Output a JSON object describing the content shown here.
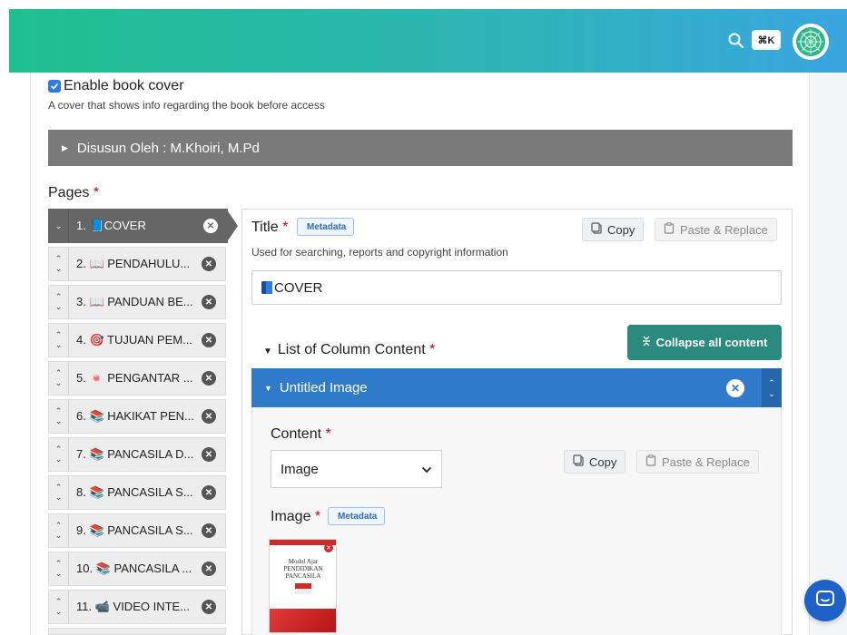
{
  "header": {
    "shortcut": "⌘K"
  },
  "cover": {
    "label": "Enable book cover",
    "help": "A cover that shows info regarding the book before access",
    "checked": true,
    "collapsible_title": "Disusun Oleh : M.Khoiri, M.Pd"
  },
  "pages": {
    "label": "Pages",
    "required": "*",
    "items": [
      {
        "label": "1. 📘COVER",
        "active": true
      },
      {
        "label": "2. 📖 PENDAHULU..."
      },
      {
        "label": "3. 📖 PANDUAN BE..."
      },
      {
        "label": "4. 🎯 TUJUAN PEM..."
      },
      {
        "label": "5. 🍬 PENGANTAR ..."
      },
      {
        "label": "6. 📚 HAKIKAT PEN..."
      },
      {
        "label": "7. 📚 PANCASILA D..."
      },
      {
        "label": "8. 📚 PANCASILA S..."
      },
      {
        "label": "9. 📚 PANCASILA S..."
      },
      {
        "label": "10. 📚 PANCASILA ..."
      },
      {
        "label": "11. 📹 VIDEO INTE..."
      }
    ]
  },
  "editor": {
    "title_label": "Title",
    "required": "*",
    "metadata_label": "Metadata",
    "title_help": "Used for searching, reports and copyright information",
    "title_value": "COVER",
    "copy_label": "Copy",
    "paste_label": "Paste & Replace",
    "list_label": "List of Column Content",
    "collapse_all_label": "Collapse all content",
    "item_title": "Untitled Image",
    "content_label": "Content",
    "content_value": "Image",
    "image_label": "Image",
    "thumb_text": "Modul Ajar PENDIDIKAN PANCASILA"
  },
  "colors": {
    "header_gradient_start": "#1fc08f",
    "header_gradient_end": "#3aa6e0",
    "accent_blue": "#2f7bc9",
    "collapse_green": "#2a8a7e"
  }
}
